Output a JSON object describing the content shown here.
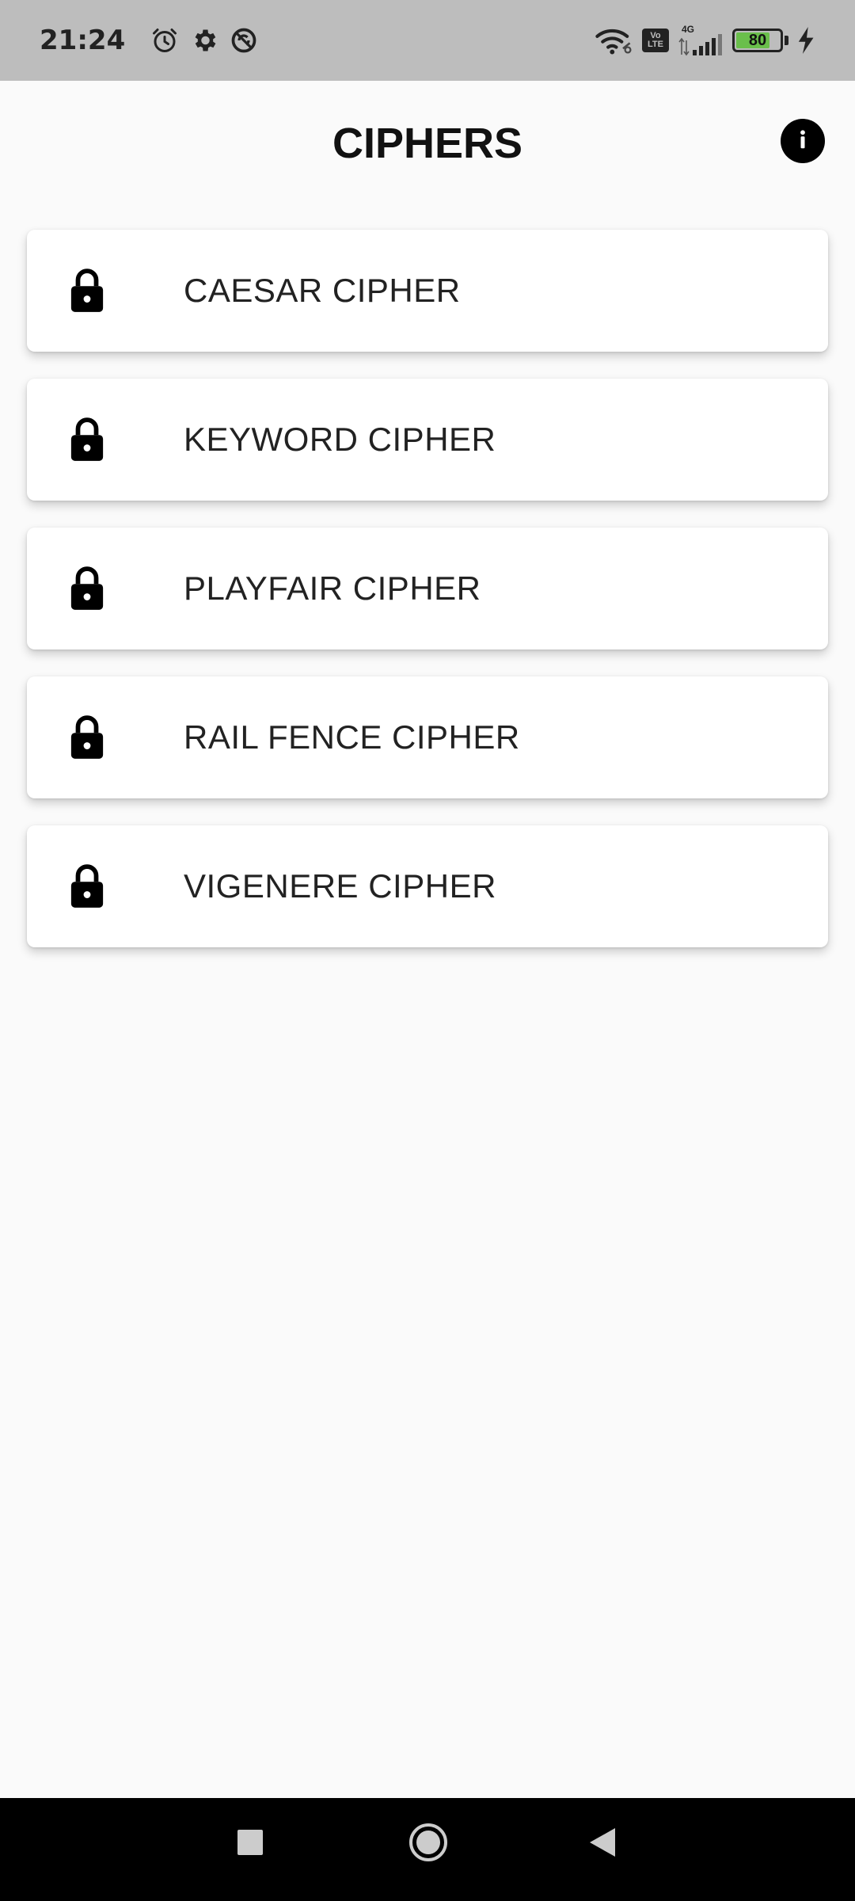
{
  "status_bar": {
    "time": "21:24",
    "network_type": "4G",
    "volte_top": "Vo",
    "volte_bottom": "LTE",
    "battery_level": "80",
    "battery_fraction": 0.8,
    "icons": [
      "alarm-icon",
      "gear-icon",
      "sync-icon",
      "wifi-icon",
      "volte-icon",
      "signal-icon",
      "battery-icon",
      "charging-icon"
    ]
  },
  "app_bar": {
    "title": "CIPHERS",
    "info_icon": "info-icon"
  },
  "ciphers": [
    {
      "label": "CAESAR CIPHER",
      "icon": "lock-icon"
    },
    {
      "label": "KEYWORD CIPHER",
      "icon": "lock-icon"
    },
    {
      "label": "PLAYFAIR CIPHER",
      "icon": "lock-icon"
    },
    {
      "label": "RAIL FENCE CIPHER",
      "icon": "lock-icon"
    },
    {
      "label": "VIGENERE CIPHER",
      "icon": "lock-icon"
    }
  ],
  "nav_bar": {
    "buttons": [
      "recents-button",
      "home-button",
      "back-button"
    ]
  },
  "colors": {
    "status_bar_bg": "#bdbdbd",
    "page_bg": "#fafafa",
    "card_bg": "#ffffff",
    "battery_fill": "#6abf4b",
    "nav_bar_bg": "#000000"
  }
}
